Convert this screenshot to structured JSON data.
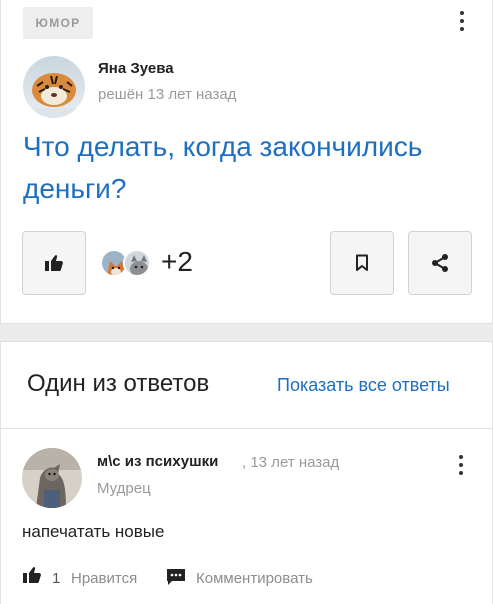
{
  "question": {
    "category": "ЮМОР",
    "author_name": "Яна Зуева",
    "author_meta": "решён 13 лет назад",
    "title": "Что делать, когда закончились деньги?",
    "likers_extra": "+2"
  },
  "answers_section": {
    "heading": "Один из ответов",
    "show_all": "Показать все ответы"
  },
  "answer": {
    "author_name": "м\\с из психушки",
    "time": ", 13 лет назад",
    "rank": "Мудрец",
    "text": "напечатать новые",
    "like_count": "1",
    "like_label": "Нравится",
    "comment_label": "Комментировать"
  },
  "icons": {
    "menu": "kebab-vertical-icon",
    "like": "thumbs-up-icon",
    "bookmark": "bookmark-icon",
    "share": "share-icon",
    "comment": "comment-icon"
  },
  "colors": {
    "link": "#1d6fc1",
    "muted": "#9a9a9a",
    "badge_bg": "#eeeeee",
    "button_bg": "#f5f5f5"
  }
}
